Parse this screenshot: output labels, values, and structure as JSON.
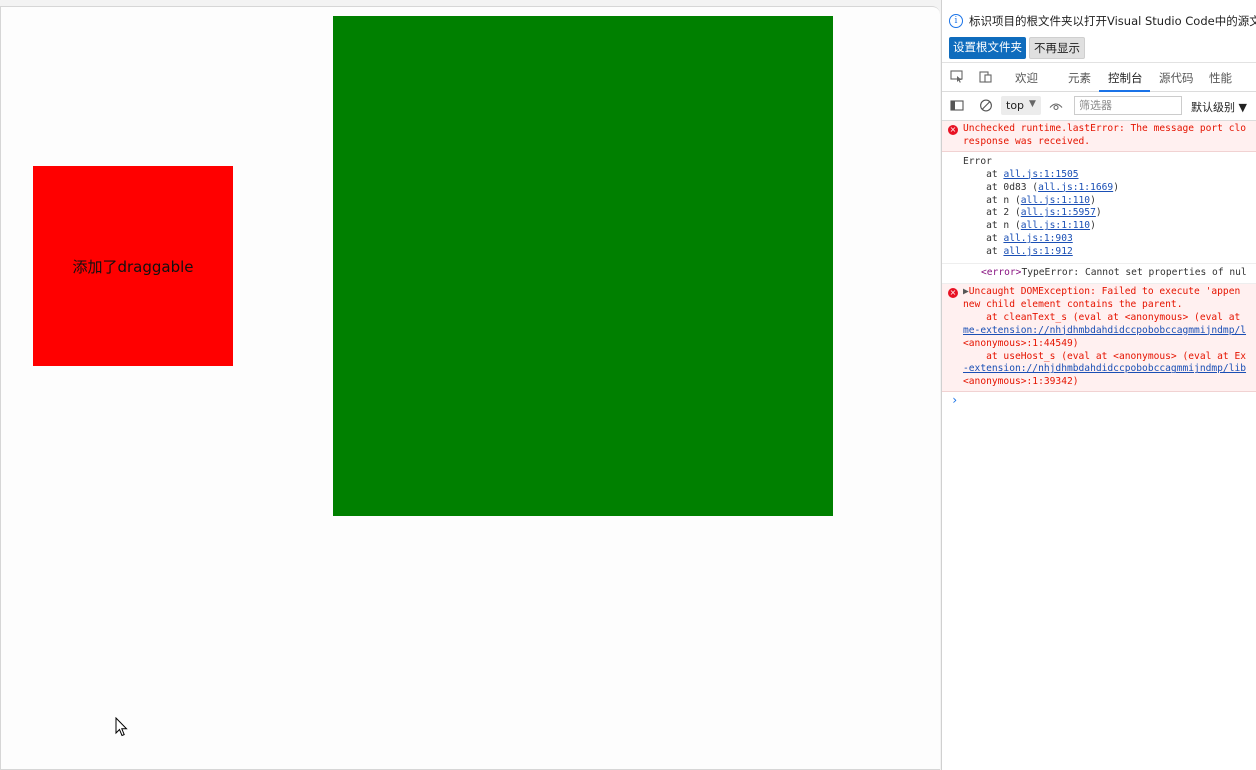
{
  "page": {
    "red_box_label": "添加了draggable",
    "colors": {
      "red_box": "#ff0000",
      "green_box": "#008000"
    }
  },
  "devtools": {
    "infobar": {
      "message": "标识项目的根文件夹以打开Visual Studio Code中的源文件并",
      "primary_button": "设置根文件夹",
      "secondary_button": "不再显示"
    },
    "tabs": {
      "welcome": "欢迎",
      "elements": "元素",
      "console": "控制台",
      "sources": "源代码",
      "performance": "性能"
    },
    "toolbar": {
      "context": "top",
      "filter_placeholder": "筛选器",
      "levels": "默认级别"
    },
    "console": {
      "error1": [
        "Unchecked runtime.lastError: The message port clo",
        "response was received."
      ],
      "error_label": "Error",
      "stack": [
        {
          "prefix": "    at ",
          "link": "all.js:1:1505",
          "suffix": ""
        },
        {
          "prefix": "    at 0d83 (",
          "link": "all.js:1:1669",
          "suffix": ")"
        },
        {
          "prefix": "    at n (",
          "link": "all.js:1:110",
          "suffix": ")"
        },
        {
          "prefix": "    at 2 (",
          "link": "all.js:1:5957",
          "suffix": ")"
        },
        {
          "prefix": "    at n (",
          "link": "all.js:1:110",
          "suffix": ")"
        },
        {
          "prefix": "    at ",
          "link": "all.js:1:903",
          "suffix": ""
        },
        {
          "prefix": "    at ",
          "link": "all.js:1:912",
          "suffix": ""
        }
      ],
      "type_error_tag": "<error>",
      "type_error_text": "TypeError: Cannot set properties of nul",
      "error2": {
        "line1": "Uncaught DOMException: Failed to execute 'appen",
        "line2": "new child element contains the parent.",
        "line3": "    at cleanText_s (eval at <anonymous> (eval at",
        "link1": "me-extension://nhjdhmbdahdidccpobobccagmmijndmp/l",
        "line5": "<anonymous>:1:44549)",
        "line6": "    at useHost_s (eval at <anonymous> (eval at Ex",
        "link2": "-extension://nhjdhmbdahdidccpobobccagmmijndmp/lib",
        "line8": "<anonymous>:1:39342)"
      },
      "prompt": "›"
    }
  }
}
